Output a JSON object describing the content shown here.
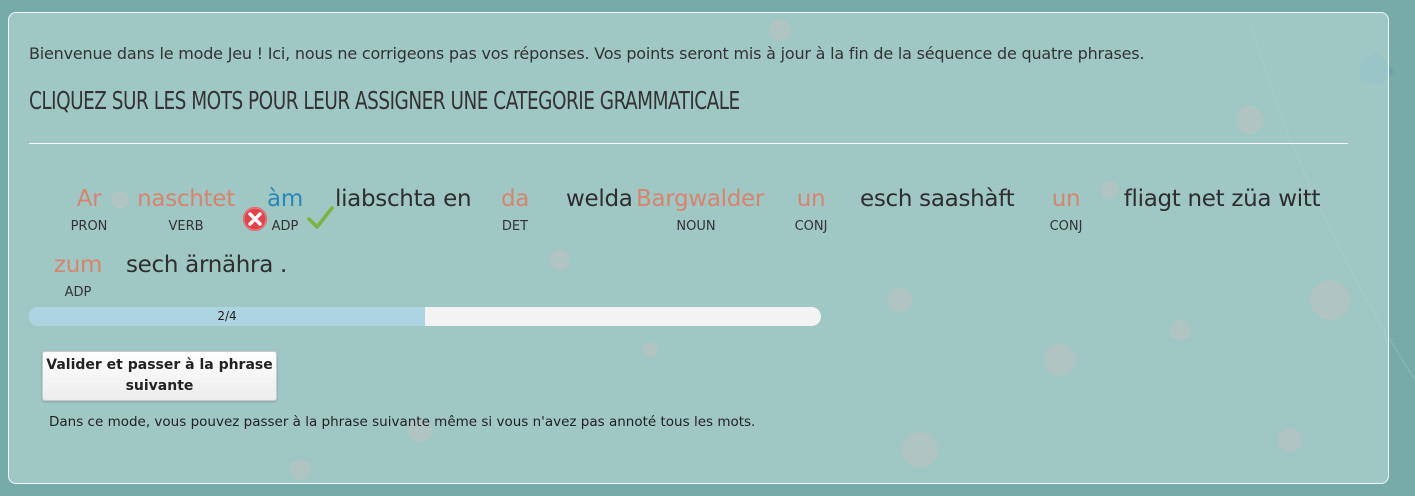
{
  "intro_text": "Bienvenue dans le mode Jeu ! Ici, nous ne corrigeons pas vos réponses. Vos points seront mis à jour à la fin de la séquence de quatre phrases.",
  "heading": "CLIQUEZ SUR LES MOTS POUR LEUR ASSIGNER UNE CATEGORIE GRAMMATICALE",
  "sentence": {
    "tokens": [
      {
        "word": "Ar",
        "category": "PRON",
        "state": "tagged"
      },
      {
        "word": "naschtet",
        "category": "VERB",
        "state": "tagged"
      },
      {
        "word": "àm",
        "category": "ADP",
        "state": "selected"
      },
      {
        "word": "liabschta en",
        "category": "",
        "state": "untagged"
      },
      {
        "word": "da",
        "category": "DET",
        "state": "tagged"
      },
      {
        "word": "welda",
        "category": "",
        "state": "untagged"
      },
      {
        "word": "Bargwalder",
        "category": "NOUN",
        "state": "tagged"
      },
      {
        "word": "un",
        "category": "CONJ",
        "state": "tagged"
      },
      {
        "word": "esch saashàft",
        "category": "",
        "state": "untagged"
      },
      {
        "word": "un",
        "category": "CONJ",
        "state": "tagged"
      },
      {
        "word": "fliagt net züa witt",
        "category": "",
        "state": "untagged"
      },
      {
        "word": "zum",
        "category": "ADP",
        "state": "tagged"
      },
      {
        "word": "sech ärnähra .",
        "category": "",
        "state": "untagged"
      }
    ]
  },
  "progress": {
    "label": "2/4",
    "current": 2,
    "total": 4
  },
  "validate_button": {
    "label_line1": "Valider et passer à la phrase",
    "label_line2": "suivante"
  },
  "note": "Dans ce mode, vous pouvez passer à la phrase suivante même si vous n'avez pas annoté tous les mots.",
  "icons": {
    "reject": "remove-tag-icon",
    "accept": "confirm-tag-icon"
  },
  "colors": {
    "tagged_word": "#d9836f",
    "selected_word": "#2a87b4",
    "plain_word": "#2e2e2e",
    "progress_fill": "#add5e1"
  }
}
